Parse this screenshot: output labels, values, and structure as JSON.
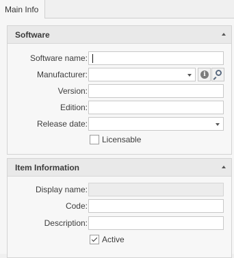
{
  "tabs": [
    {
      "label": "Main Info",
      "selected": true
    }
  ],
  "software_group": {
    "title": "Software",
    "fields": {
      "software_name": {
        "label": "Software name:",
        "required": true,
        "value": ""
      },
      "manufacturer": {
        "label": "Manufacturer:",
        "required": true,
        "value": ""
      },
      "version": {
        "label": "Version:",
        "value": ""
      },
      "edition": {
        "label": "Edition:",
        "value": ""
      },
      "release_date": {
        "label": "Release date:",
        "value": ""
      }
    },
    "licensable": {
      "label": "Licensable",
      "checked": false
    }
  },
  "item_group": {
    "title": "Item Information",
    "fields": {
      "display_name": {
        "label": "Display name:",
        "value": "",
        "disabled": true
      },
      "code": {
        "label": "Code:",
        "value": ""
      },
      "description": {
        "label": "Description:",
        "value": ""
      }
    },
    "active": {
      "label": "Active",
      "checked": true
    }
  },
  "icons": [
    "info-icon",
    "search-icon",
    "dropdown-arrow-icon",
    "collapse-icon"
  ],
  "colors": {
    "required_marker": "#d23a3a",
    "header_bg": "#e9e9e9",
    "panel_bg": "#f6f6f6"
  }
}
